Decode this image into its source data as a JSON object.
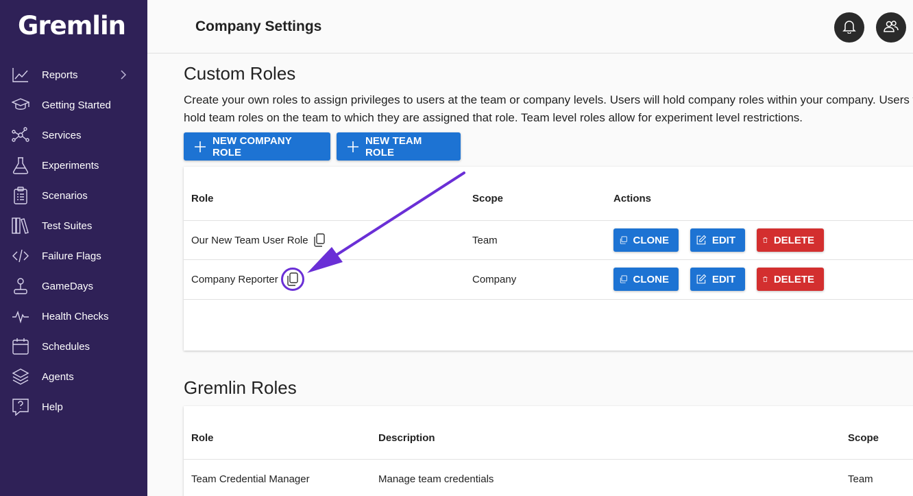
{
  "app": {
    "logo": "Gremlin"
  },
  "sidebar": {
    "items": [
      {
        "label": "Reports",
        "icon": "chart-line-icon",
        "has_submenu": true
      },
      {
        "label": "Getting Started",
        "icon": "graduation-cap-icon"
      },
      {
        "label": "Services",
        "icon": "network-nodes-icon"
      },
      {
        "label": "Experiments",
        "icon": "flask-icon"
      },
      {
        "label": "Scenarios",
        "icon": "clipboard-icon"
      },
      {
        "label": "Test Suites",
        "icon": "books-icon"
      },
      {
        "label": "Failure Flags",
        "icon": "code-icon"
      },
      {
        "label": "GameDays",
        "icon": "joystick-icon"
      },
      {
        "label": "Health Checks",
        "icon": "pulse-icon"
      },
      {
        "label": "Schedules",
        "icon": "calendar-icon"
      },
      {
        "label": "Agents",
        "icon": "layers-icon"
      },
      {
        "label": "Help",
        "icon": "help-bubble-icon"
      }
    ]
  },
  "header": {
    "title": "Company Settings",
    "notifications_icon": "bell-icon",
    "users_icon": "users-icon"
  },
  "custom_roles": {
    "title": "Custom Roles",
    "description": "Create your own roles to assign privileges to users at the team or company levels. Users will hold company roles within your company. Users will hold team roles on the team to which they are assigned that role. Team level roles allow for experiment level restrictions.",
    "new_company_role_label": "NEW COMPANY ROLE",
    "new_team_role_label": "NEW TEAM ROLE",
    "columns": [
      "Role",
      "Scope",
      "Actions"
    ],
    "rows": [
      {
        "role": "Our New Team User Role",
        "scope": "Team"
      },
      {
        "role": "Company Reporter",
        "scope": "Company"
      }
    ],
    "actions": {
      "clone": "CLONE",
      "edit": "EDIT",
      "delete": "DELETE"
    }
  },
  "gremlin_roles": {
    "title": "Gremlin Roles",
    "columns": [
      "Role",
      "Description",
      "Scope"
    ],
    "rows": [
      {
        "role": "Team Credential Manager",
        "description": "Manage team credentials",
        "scope": "Team"
      }
    ]
  },
  "colors": {
    "sidebar_bg": "#2f2157",
    "primary_button": "#1d73d3",
    "delete_button": "#d32f2f",
    "annotation": "#6a2fd6"
  }
}
